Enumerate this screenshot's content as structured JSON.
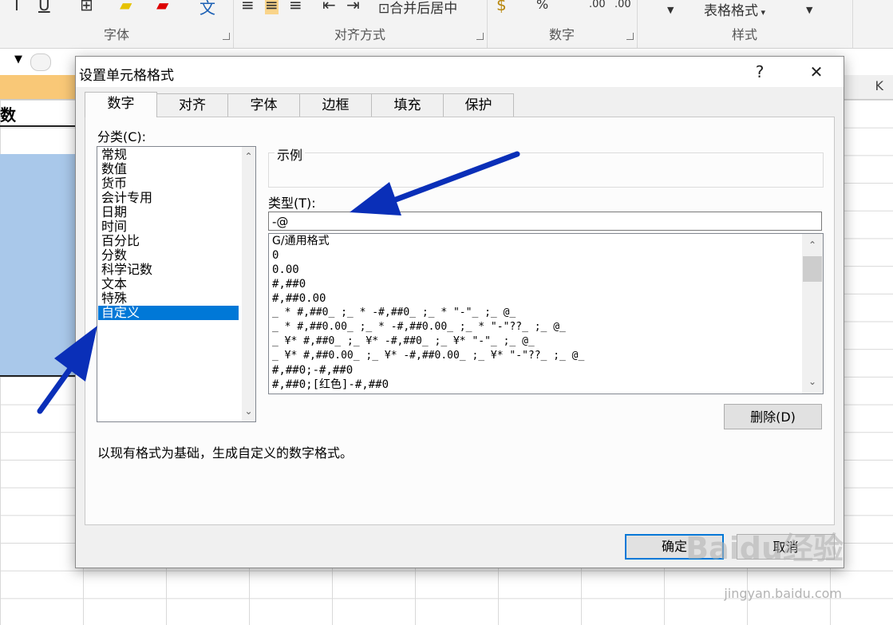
{
  "ribbon": {
    "groups": [
      {
        "label": "字体"
      },
      {
        "label": "对齐方式"
      },
      {
        "label": "数字"
      },
      {
        "label": "样式"
      }
    ],
    "table_format_label": "表格格式",
    "merge_label": "合并后居中",
    "percent_label": "%"
  },
  "sheet": {
    "column_k": "K",
    "cell_text": "数"
  },
  "dialog": {
    "title": "设置单元格格式",
    "help_label": "?",
    "close_label": "✕",
    "tabs": [
      {
        "label": "数字"
      },
      {
        "label": "对齐"
      },
      {
        "label": "字体"
      },
      {
        "label": "边框"
      },
      {
        "label": "填充"
      },
      {
        "label": "保护"
      }
    ],
    "category_label": "分类(C):",
    "categories": [
      "常规",
      "数值",
      "货币",
      "会计专用",
      "日期",
      "时间",
      "百分比",
      "分数",
      "科学记数",
      "文本",
      "特殊",
      "自定义"
    ],
    "selected_category": "自定义",
    "example_label": "示例",
    "type_label": "类型(T):",
    "type_value": "-@",
    "formats": [
      "G/通用格式",
      "0",
      "0.00",
      "#,##0",
      "#,##0.00",
      "_ * #,##0_ ;_ * -#,##0_ ;_ * \"-\"_ ;_ @_",
      "_ * #,##0.00_ ;_ * -#,##0.00_ ;_ * \"-\"??_ ;_ @_",
      "_ ¥* #,##0_ ;_ ¥* -#,##0_ ;_ ¥* \"-\"_ ;_ @_",
      "_ ¥* #,##0.00_ ;_ ¥* -#,##0.00_ ;_ ¥* \"-\"??_ ;_ @_",
      "#,##0;-#,##0",
      "#,##0;[红色]-#,##0"
    ],
    "delete_label": "删除(D)",
    "description": "以现有格式为基础，生成自定义的数字格式。",
    "ok_label": "确定",
    "cancel_label": "取消"
  },
  "watermark": {
    "text": "Baidu经验",
    "sub": "jingyan.baidu.com"
  },
  "colors": {
    "selection": "#0078d7",
    "annotation_arrow": "#0a2fb8"
  }
}
